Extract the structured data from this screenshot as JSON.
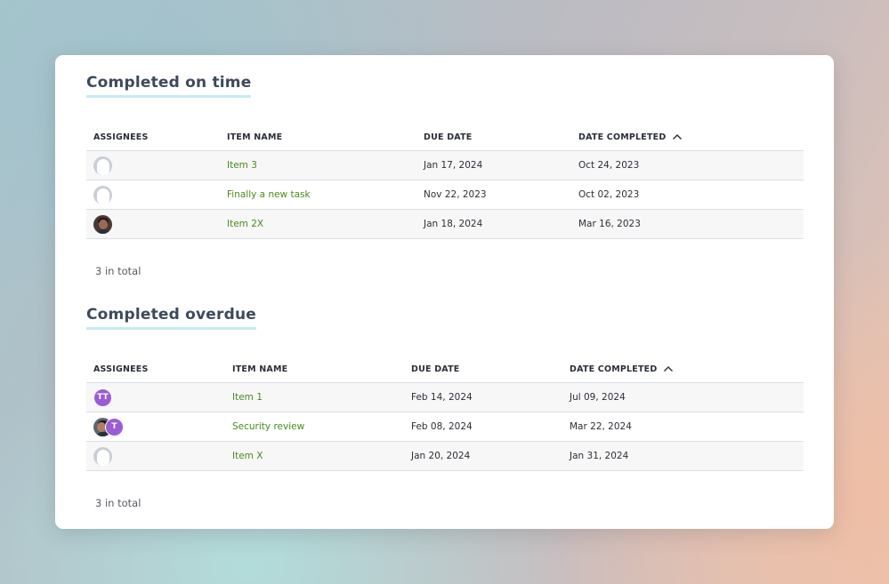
{
  "sections": [
    {
      "title": "Completed on time",
      "columns": {
        "assignees": "ASSIGNEES",
        "item_name": "ITEM NAME",
        "due_date": "DUE DATE",
        "date_completed": "DATE COMPLETED"
      },
      "rows": [
        {
          "item": "Item 3",
          "due": "Jan 17, 2024",
          "completed": "Oct 24, 2023"
        },
        {
          "item": "Finally a new task",
          "due": "Nov 22, 2023",
          "completed": "Oct 02, 2023"
        },
        {
          "item": "Item 2X",
          "due": "Jan 18, 2024",
          "completed": "Mar 16, 2023"
        }
      ],
      "total": "3 in total"
    },
    {
      "title": "Completed overdue",
      "columns": {
        "assignees": "ASSIGNEES",
        "item_name": "ITEM NAME",
        "due_date": "DUE DATE",
        "date_completed": "DATE COMPLETED"
      },
      "rows": [
        {
          "item": "Item 1",
          "due": "Feb 14, 2024",
          "completed": "Jul 09, 2024"
        },
        {
          "item": "Security review",
          "due": "Feb 08, 2024",
          "completed": "Mar 22, 2024"
        },
        {
          "item": "Item X",
          "due": "Jan 20, 2024",
          "completed": "Jan 31, 2024"
        }
      ],
      "total": "3 in total"
    }
  ],
  "avatars": {
    "initials_tt": "TT",
    "initials_t": "T"
  },
  "colors": {
    "link": "#4a8a1c",
    "title": "#3d4a5c",
    "title_underline": "#c5ecf4",
    "avatar_purple": "#9b5cd6"
  },
  "icons": {
    "sort": "chevron-up-icon",
    "placeholder_avatar": "user-placeholder-icon"
  }
}
